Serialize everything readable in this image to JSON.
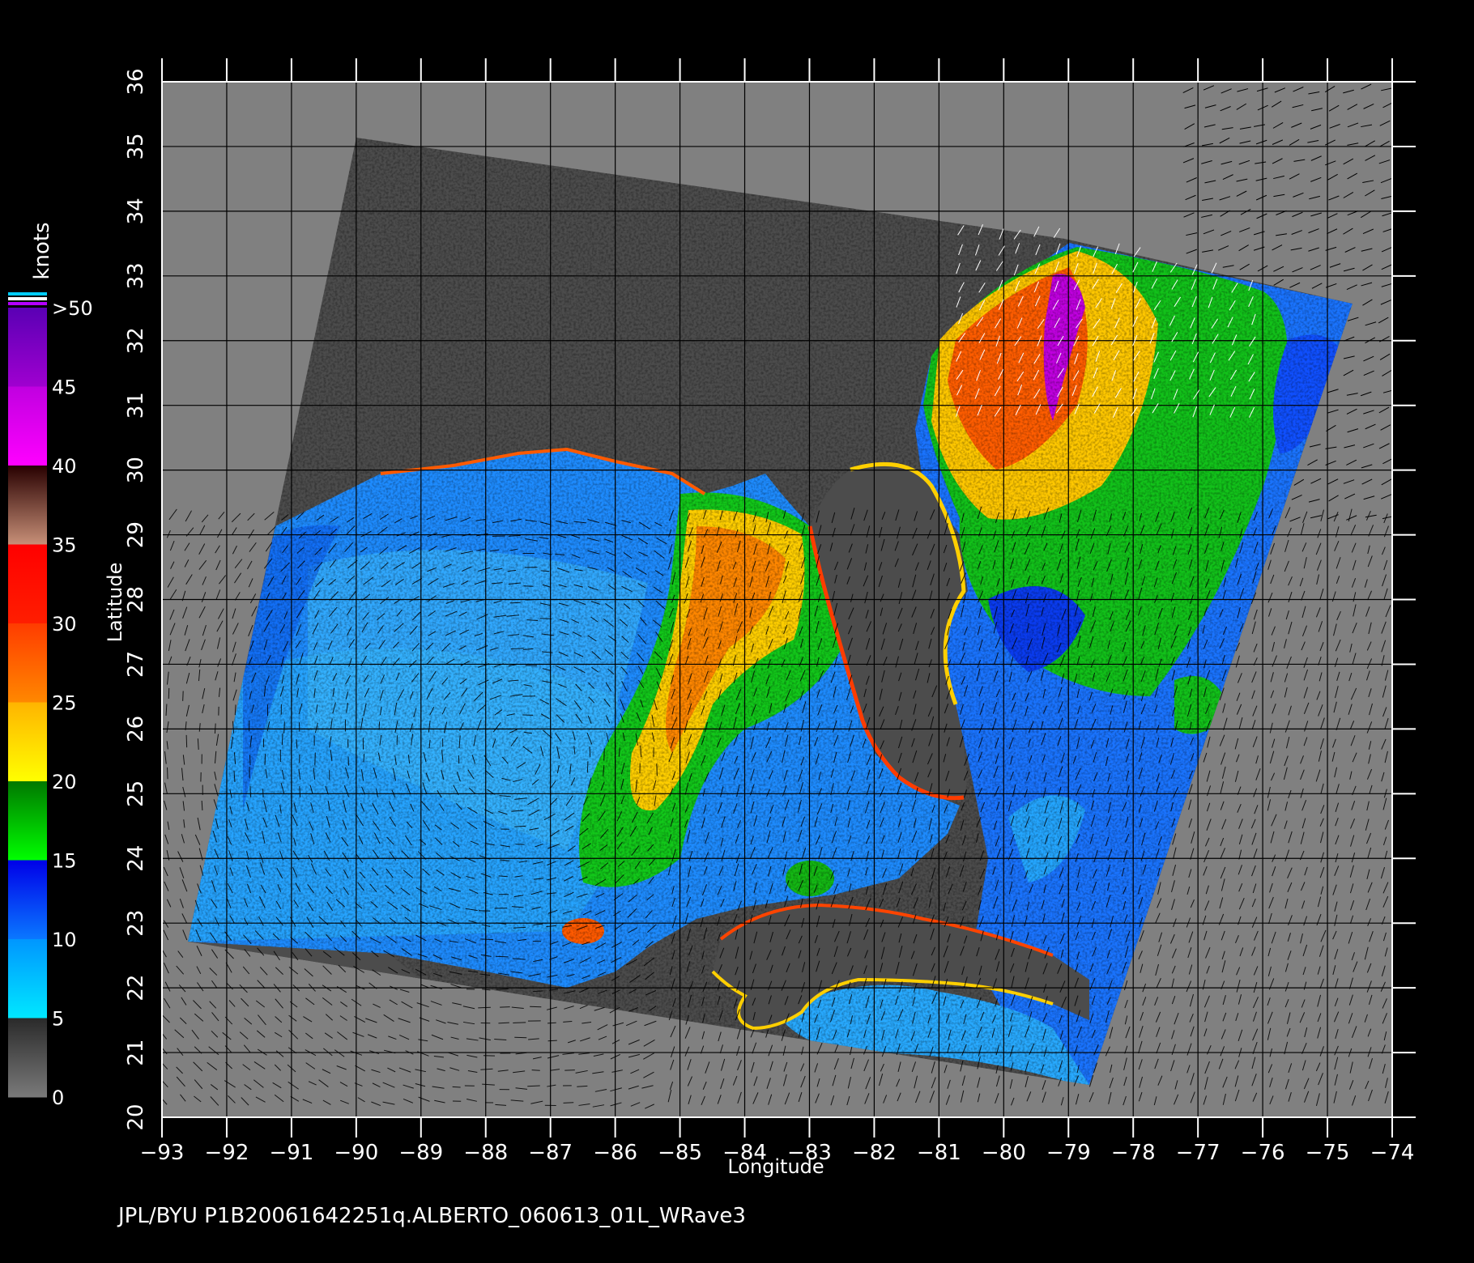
{
  "figure": {
    "footer": "JPL/BYU  P1B20061642251q.ALBERTO_060613_01L_WRave3",
    "xlabel": "Longitude",
    "ylabel": "Latitude"
  },
  "axes": {
    "lon_range": [
      -93,
      -74
    ],
    "lat_range": [
      20,
      36
    ],
    "lon_ticks": [
      "−93",
      "−92",
      "−91",
      "−90",
      "−89",
      "−88",
      "−87",
      "−86",
      "−85",
      "−84",
      "−83",
      "−82",
      "−81",
      "−80",
      "−79",
      "−78",
      "−77",
      "−76",
      "−75",
      "−74"
    ],
    "lat_ticks": [
      "20",
      "21",
      "22",
      "23",
      "24",
      "25",
      "26",
      "27",
      "28",
      "29",
      "30",
      "31",
      "32",
      "33",
      "34",
      "35",
      "36"
    ],
    "grid": true
  },
  "colorbar": {
    "unit": "knots",
    "labels": [
      "0",
      "5",
      "10",
      "15",
      "20",
      "25",
      "30",
      "35",
      "40",
      "45",
      ">50"
    ],
    "bins": [
      {
        "from": 0,
        "to": 5,
        "colors": [
          "#7a7a7a",
          "#2a2a2a"
        ]
      },
      {
        "from": 5,
        "to": 10,
        "colors": [
          "#00e8ff",
          "#0096ff"
        ]
      },
      {
        "from": 10,
        "to": 15,
        "colors": [
          "#0a78ff",
          "#0000e8"
        ]
      },
      {
        "from": 15,
        "to": 20,
        "colors": [
          "#00ff00",
          "#007800"
        ]
      },
      {
        "from": 20,
        "to": 25,
        "colors": [
          "#ffff00",
          "#ffb400"
        ]
      },
      {
        "from": 25,
        "to": 30,
        "colors": [
          "#ff8800",
          "#ff3c00"
        ]
      },
      {
        "from": 30,
        "to": 35,
        "colors": [
          "#ff1e00",
          "#ff0000"
        ]
      },
      {
        "from": 35,
        "to": 40,
        "colors": [
          "#c89078",
          "#280000"
        ]
      },
      {
        "from": 40,
        "to": 45,
        "colors": [
          "#ff00ff",
          "#c000e0"
        ]
      },
      {
        "from": 45,
        "to": 50,
        "colors": [
          "#a000d0",
          "#5a00b4"
        ]
      }
    ],
    "overflow_colors": [
      "#00ccff",
      "#ffffff",
      "#b400ff"
    ]
  },
  "map_colors": {
    "background": "#000000",
    "outside_swath": "#808080",
    "land": "#4c4c4c",
    "grid": "#000000"
  }
}
